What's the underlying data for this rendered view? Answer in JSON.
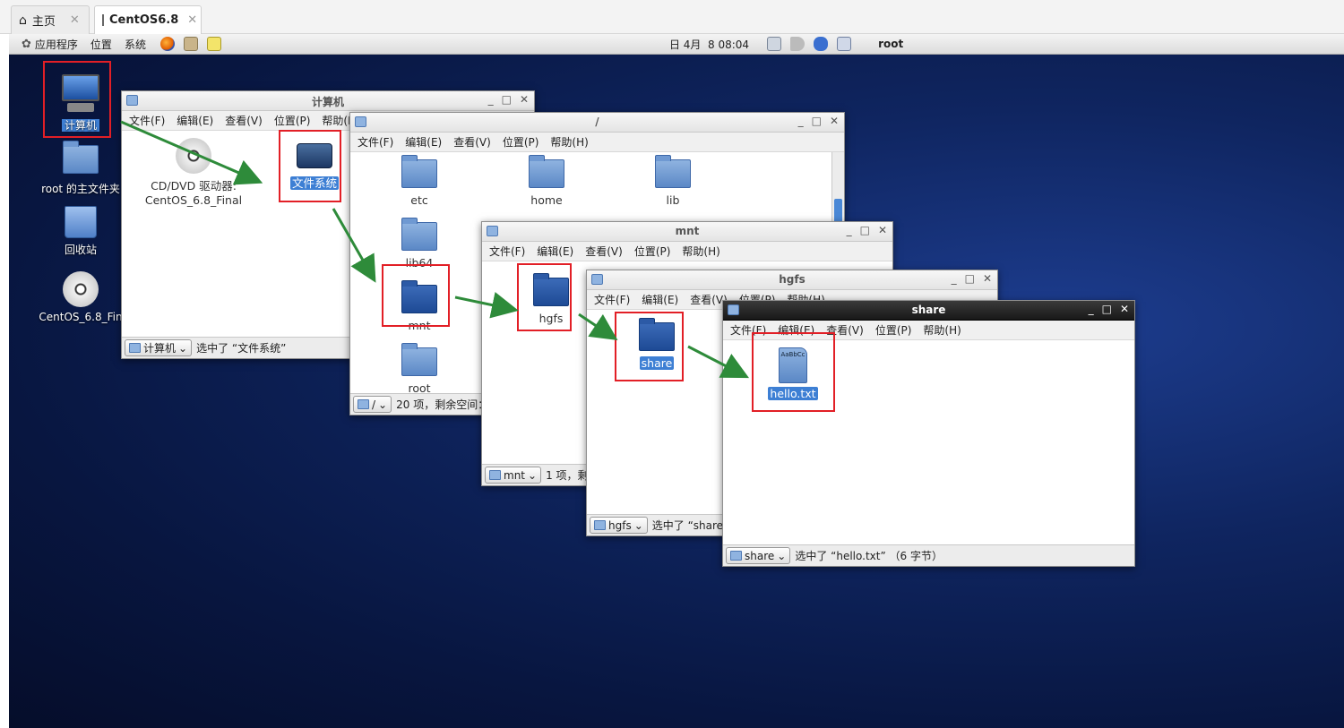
{
  "vm_tabs": [
    {
      "label": "主页"
    },
    {
      "label": "CentOS6.8"
    }
  ],
  "panel": {
    "applications": "应用程序",
    "places": "位置",
    "system": "系统",
    "datetime": "日 4月  8 08:04",
    "user": "root"
  },
  "desktop": [
    {
      "label": "计算机"
    },
    {
      "label": "root 的主文件夹"
    },
    {
      "label": "回收站"
    },
    {
      "label": "CentOS_6.8_Fin"
    }
  ],
  "menu": [
    "文件(F)",
    "编辑(E)",
    "查看(V)",
    "位置(P)",
    "帮助(H)"
  ],
  "win_computer": {
    "title": "计算机",
    "dvd_label1": "CD/DVD 驱动器:",
    "dvd_label2": "CentOS_6.8_Final",
    "fs_label": "文件系统",
    "crumb": "计算机",
    "status": "选中了 “文件系统”"
  },
  "win_root": {
    "title": "/",
    "items": [
      "etc",
      "home",
      "lib",
      "lib64",
      "mnt",
      "root"
    ],
    "crumb": "/",
    "status": "20 项，剩余空间："
  },
  "win_mnt": {
    "title": "mnt",
    "item": "hgfs",
    "crumb": "mnt",
    "status": "1 项，剩余"
  },
  "win_hgfs": {
    "title": "hgfs",
    "item": "share",
    "crumb": "hgfs",
    "status": "选中了 “share”"
  },
  "win_share": {
    "title": "share",
    "item": "hello.txt",
    "crumb": "share",
    "status": "选中了 “hello.txt” （6 字节）"
  },
  "icons": {
    "home": "home-icon",
    "folder": "folder-icon",
    "file": "text-file-icon",
    "dvd": "dvd-icon",
    "computer": "computer-icon",
    "trash": "trash-icon",
    "arrow": "green-arrow"
  },
  "colors": {
    "highlight": "#e21f26",
    "arrow": "#2e8b3a",
    "selection": "#3d7fd4"
  }
}
